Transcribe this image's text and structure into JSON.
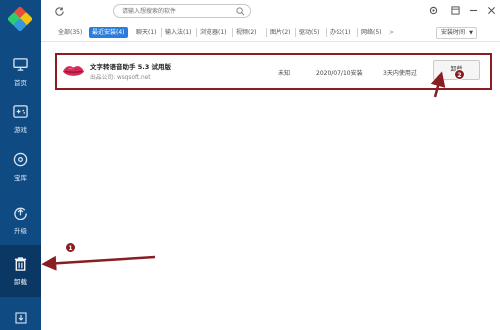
{
  "sidebar": {
    "items": [
      {
        "label": "首页",
        "icon": "monitor-icon"
      },
      {
        "label": "游戏",
        "icon": "gamepad-icon"
      },
      {
        "label": "宝库",
        "icon": "disc-icon"
      },
      {
        "label": "升级",
        "icon": "upgrade-icon"
      },
      {
        "label": "卸载",
        "icon": "trash-icon"
      }
    ],
    "bottom_icon": "download-icon"
  },
  "search": {
    "placeholder": "请输入想搜索的软件"
  },
  "tabs": [
    {
      "label": "全部(35)"
    },
    {
      "label": "最近安装(4)"
    },
    {
      "label": "聊天(1)"
    },
    {
      "label": "输入法(1)"
    },
    {
      "label": "浏览器(1)"
    },
    {
      "label": "视频(2)"
    },
    {
      "label": "图片(2)"
    },
    {
      "label": "驱动(5)"
    },
    {
      "label": "办公(1)"
    },
    {
      "label": "网络(5)"
    }
  ],
  "sort": {
    "label": "安装时间"
  },
  "app": {
    "name": "文字转语音助手 5.3 试用版",
    "publisher": "出品公司: wsqsoft.net",
    "size": "未知",
    "install_date": "2020/07/10安装",
    "usage": "3天内使用过",
    "action_label": "卸载"
  },
  "annotations": {
    "badge1": "1",
    "badge2": "2"
  },
  "colors": {
    "sidebar": "#0f4a83",
    "accent": "#2b7ddb",
    "annotation": "#8a1d22"
  }
}
